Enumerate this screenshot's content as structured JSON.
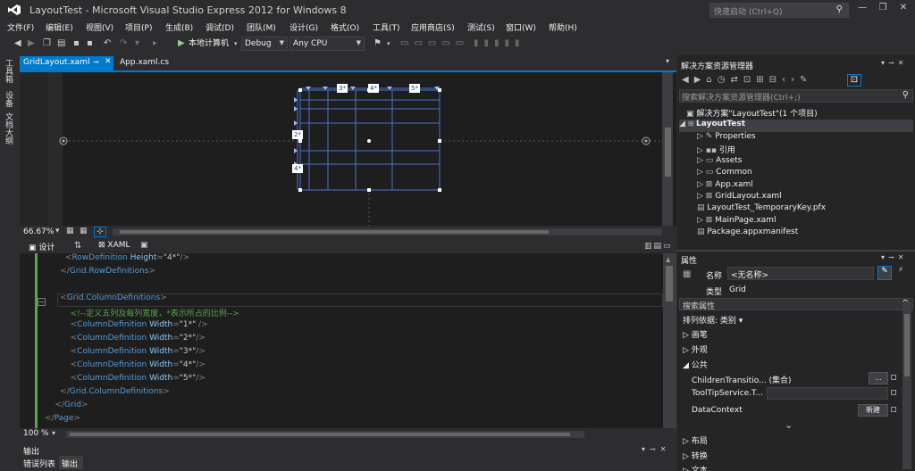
{
  "window": {
    "title": "LayoutTest - Microsoft Visual Studio Express 2012 for Windows 8",
    "quick_launch": "快速启动 (Ctrl+Q)"
  },
  "menu": [
    "文件(F)",
    "编辑(E)",
    "视图(V)",
    "项目(P)",
    "生成(B)",
    "调试(D)",
    "团队(M)",
    "设计(G)",
    "格式(O)",
    "工具(T)",
    "应用商店(S)",
    "测试(S)",
    "窗口(W)",
    "帮助(H)"
  ],
  "toolbar": {
    "run_target": "本地计算机",
    "config": "Debug",
    "platform": "Any CPU"
  },
  "left_tabs": [
    "工具箱",
    "设备",
    "文档大纲"
  ],
  "doc_tabs": [
    {
      "label": "GridLayout.xaml",
      "active": true
    },
    {
      "label": "App.xaml.cs",
      "active": false
    }
  ],
  "designer": {
    "zoom": "66.67%",
    "col_labels": [
      "3*",
      "4*",
      "5*"
    ],
    "row_labels": [
      "2*",
      "4*"
    ]
  },
  "split": {
    "design_tab": "设计",
    "xaml_tab": "XAML"
  },
  "code": {
    "zoom": "100 %",
    "lines": [
      {
        "indent": "        ",
        "parts": [
          [
            "tg",
            "<"
          ],
          [
            "tn",
            "RowDefinition"
          ],
          [
            "an",
            " Height"
          ],
          [
            "tg",
            "="
          ],
          [
            "av",
            "\"4*\""
          ],
          [
            "tg",
            "/>"
          ]
        ]
      },
      {
        "indent": "      ",
        "parts": [
          [
            "tg",
            "</"
          ],
          [
            "tn",
            "Grid.RowDefinitions"
          ],
          [
            "tg",
            ">"
          ]
        ]
      },
      {
        "indent": "",
        "parts": []
      },
      {
        "indent": "      ",
        "parts": [
          [
            "tg",
            "<"
          ],
          [
            "tn",
            "Grid.ColumnDefinitions"
          ],
          [
            "tg",
            ">"
          ]
        ]
      },
      {
        "indent": "          ",
        "parts": [
          [
            "cm",
            "<!--定义五列及每列宽度，*表示所占的比例-->"
          ]
        ]
      },
      {
        "indent": "          ",
        "parts": [
          [
            "tg",
            "<"
          ],
          [
            "tn",
            "ColumnDefinition"
          ],
          [
            "an",
            " Width"
          ],
          [
            "tg",
            "="
          ],
          [
            "av",
            "\"1*\""
          ],
          [
            "tg",
            " />"
          ]
        ]
      },
      {
        "indent": "          ",
        "parts": [
          [
            "tg",
            "<"
          ],
          [
            "tn",
            "ColumnDefinition"
          ],
          [
            "an",
            " Width"
          ],
          [
            "tg",
            "="
          ],
          [
            "av",
            "\"2*\""
          ],
          [
            "tg",
            "/>"
          ]
        ]
      },
      {
        "indent": "          ",
        "parts": [
          [
            "tg",
            "<"
          ],
          [
            "tn",
            "ColumnDefinition"
          ],
          [
            "an",
            " Width"
          ],
          [
            "tg",
            "="
          ],
          [
            "av",
            "\"3*\""
          ],
          [
            "tg",
            "/>"
          ]
        ]
      },
      {
        "indent": "          ",
        "parts": [
          [
            "tg",
            "<"
          ],
          [
            "tn",
            "ColumnDefinition"
          ],
          [
            "an",
            " Width"
          ],
          [
            "tg",
            "="
          ],
          [
            "av",
            "\"4*\""
          ],
          [
            "tg",
            "/>"
          ]
        ]
      },
      {
        "indent": "          ",
        "parts": [
          [
            "tg",
            "<"
          ],
          [
            "tn",
            "ColumnDefinition"
          ],
          [
            "an",
            " Width"
          ],
          [
            "tg",
            "="
          ],
          [
            "av",
            "\"5*\""
          ],
          [
            "tg",
            "/>"
          ]
        ]
      },
      {
        "indent": "      ",
        "parts": [
          [
            "tg",
            "</"
          ],
          [
            "tn",
            "Grid.ColumnDefinitions"
          ],
          [
            "tg",
            ">"
          ]
        ]
      },
      {
        "indent": "    ",
        "parts": [
          [
            "tg",
            "</"
          ],
          [
            "tn",
            "Grid"
          ],
          [
            "tg",
            ">"
          ]
        ]
      },
      {
        "indent": "",
        "parts": [
          [
            "tg",
            "</"
          ],
          [
            "tn",
            "Page"
          ],
          [
            "tg",
            ">"
          ]
        ]
      }
    ]
  },
  "output": {
    "title": "输出",
    "tabs": [
      "错误列表",
      "输出"
    ]
  },
  "solution_explorer": {
    "title": "解决方案资源管理器",
    "search_placeholder": "搜索解决方案资源管理器(Ctrl+;)",
    "solution": "解决方案\"LayoutTest\"(1 个项目)",
    "project": "LayoutTest",
    "items": [
      "Properties",
      "引用",
      "Assets",
      "Common",
      "App.xaml",
      "GridLayout.xaml",
      "LayoutTest_TemporaryKey.pfx",
      "MainPage.xaml",
      "Package.appxmanifest"
    ]
  },
  "properties": {
    "title": "属性",
    "name_label": "名称",
    "name_value": "<无名称>",
    "type_label": "类型",
    "type_value": "Grid",
    "search_label": "搜索属性",
    "arrange_label": "排列依据: 类别 ▾",
    "categories": [
      "画笔",
      "外观",
      "公共",
      "布局",
      "转换",
      "文本"
    ],
    "common_props": [
      {
        "name": "ChildrenTransitio... (集合)",
        "button": "..."
      },
      {
        "name": "ToolTipService.T...",
        "button": ""
      },
      {
        "name": "DataContext",
        "button": "新建"
      }
    ]
  },
  "colors": {
    "accent": "#007acc",
    "background": "#2d2d30",
    "editor": "#1e1e1e"
  }
}
